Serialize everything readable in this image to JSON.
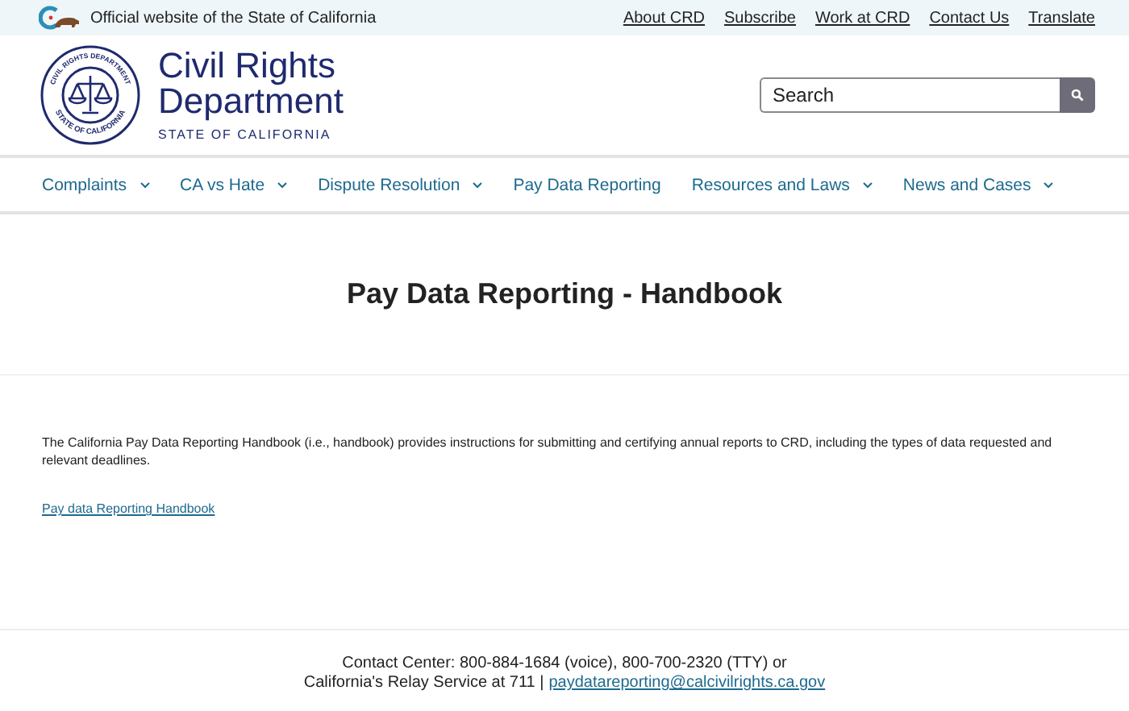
{
  "official_bar": {
    "text": "Official website of the State of California",
    "links": [
      "About CRD",
      "Subscribe",
      "Work at CRD",
      "Contact Us",
      "Translate"
    ]
  },
  "header": {
    "seal_top": "CIVIL RIGHTS DEPARTMENT",
    "seal_bottom": "STATE OF CALIFORNIA",
    "title_line_1": "Civil Rights",
    "title_line_2": "Department",
    "subtitle": "STATE OF CALIFORNIA",
    "search": {
      "placeholder": "Search"
    }
  },
  "nav": [
    {
      "label": "Complaints",
      "has_menu": true
    },
    {
      "label": "CA vs Hate",
      "has_menu": true
    },
    {
      "label": "Dispute Resolution",
      "has_menu": true
    },
    {
      "label": "Pay Data Reporting",
      "has_menu": false
    },
    {
      "label": "Resources and Laws",
      "has_menu": true
    },
    {
      "label": "News and Cases",
      "has_menu": true
    }
  ],
  "page_title": "Pay Data Reporting - Handbook",
  "body": {
    "paragraph": "The California Pay Data Reporting Handbook (i.e., handbook) provides instructions for submitting and certifying annual reports to CRD, including the types of data requested and relevant deadlines.",
    "link": "Pay data Reporting Handbook"
  },
  "footer": {
    "line_1": "Contact Center: 800-884-1684 (voice), 800-700-2320 (TTY) or",
    "line_2": "California's Relay Service at 711 |",
    "email": "paydatareporting@calcivilrights.ca.gov"
  }
}
